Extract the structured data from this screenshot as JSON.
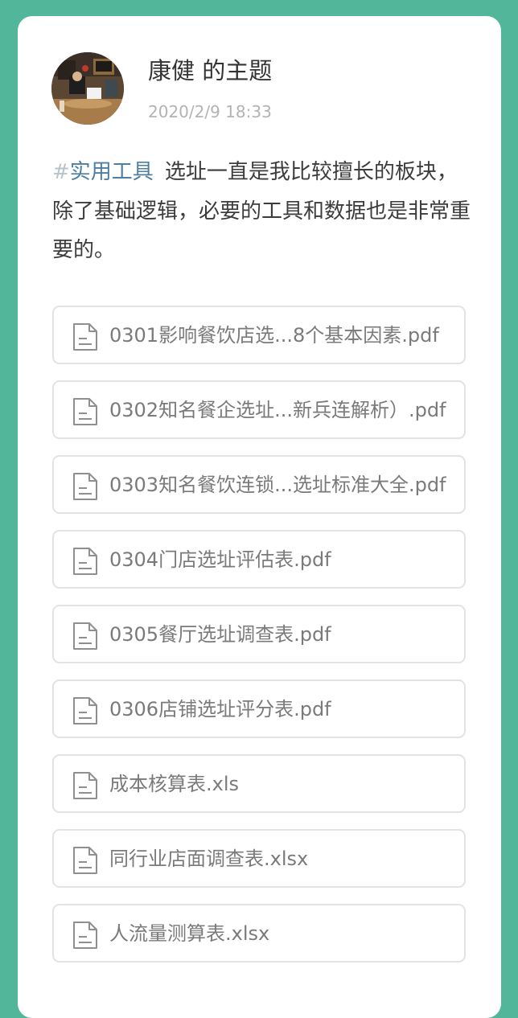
{
  "post": {
    "author": "康健 的主题",
    "time": "2020/2/9 18:33",
    "hash": "#",
    "tag": "实用工具",
    "text": "选址一直是我比较擅长的板块，除了基础逻辑，必要的工具和数据也是非常重要的。"
  },
  "files": [
    {
      "name": "0301影响餐饮店选...8个基本因素.pdf",
      "icon": "document-icon"
    },
    {
      "name": "0302知名餐企选址...新兵连解析）.pdf",
      "icon": "document-icon"
    },
    {
      "name": "0303知名餐饮连锁...选址标准大全.pdf",
      "icon": "document-icon"
    },
    {
      "name": "0304门店选址评估表.pdf",
      "icon": "document-icon"
    },
    {
      "name": "0305餐厅选址调查表.pdf",
      "icon": "document-icon"
    },
    {
      "name": "0306店铺选址评分表.pdf",
      "icon": "document-icon"
    },
    {
      "name": "成本核算表.xls",
      "icon": "document-icon"
    },
    {
      "name": "同行业店面调查表.xlsx",
      "icon": "document-icon"
    },
    {
      "name": "人流量测算表.xlsx",
      "icon": "document-icon"
    }
  ],
  "colors": {
    "background": "#52b79a",
    "card": "#ffffff",
    "tag": "#4e7ea2",
    "file_text": "#7a7a7a",
    "file_border": "#e3e3e3"
  }
}
